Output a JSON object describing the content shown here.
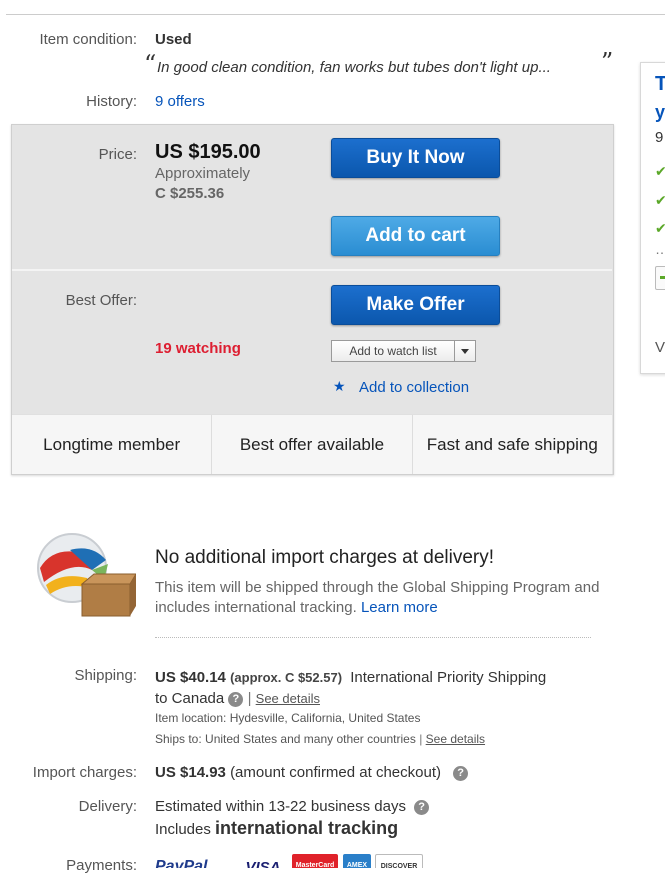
{
  "condition": {
    "label": "Item condition:",
    "value": "Used",
    "note": "In good clean condition, fan works but tubes don't light up..."
  },
  "history": {
    "label": "History:",
    "value": "9 offers"
  },
  "price": {
    "label": "Price:",
    "amount": "US $195.00",
    "approx_label": "Approximately",
    "approx_value": "C $255.36"
  },
  "buttons": {
    "buy_now": "Buy It Now",
    "add_to_cart": "Add to cart",
    "make_offer": "Make Offer",
    "watch_list": "Add to watch list",
    "add_collection": "Add to collection"
  },
  "best_offer": {
    "label": "Best Offer:"
  },
  "watching": "19 watching",
  "features": [
    "Longtime member",
    "Best offer available",
    "Fast and safe shipping"
  ],
  "seller_card": {
    "title_fragment": "T",
    "line2": "y",
    "line3": "9",
    "footer": "V"
  },
  "gsp": {
    "title": "No additional import charges at delivery!",
    "text": "This item will be shipped through the Global Shipping Program and includes international tracking.",
    "learn_more": "Learn more"
  },
  "shipping": {
    "label": "Shipping:",
    "amount": "US $40.14",
    "approx": "(approx. C $52.57)",
    "service": "International Priority Shipping",
    "destination": "to Canada",
    "see_details": "See details",
    "location_label": "Item location:",
    "location": "Hydesville, California, United States",
    "ships_to_label": "Ships to:",
    "ships_to": "United States and many other countries",
    "see_details2": "See details"
  },
  "import_charges": {
    "label": "Import charges:",
    "amount": "US $14.93",
    "note": "(amount confirmed at checkout)"
  },
  "delivery": {
    "label": "Delivery:",
    "estimate": "Estimated within 13-22 business days",
    "includes": "Includes",
    "tracking": "international tracking"
  },
  "payments": {
    "label": "Payments:",
    "paypal": "PayPal",
    "visa": "VISA",
    "mastercard": "MasterCard",
    "amex": "AMEX",
    "discover": "DISCOVER"
  },
  "colors": {
    "link": "#0654ba",
    "watching_red": "#dd1e31",
    "button_dark": "#0b57ad",
    "button_light": "#2a8dd2",
    "check_green": "#5ba829"
  }
}
